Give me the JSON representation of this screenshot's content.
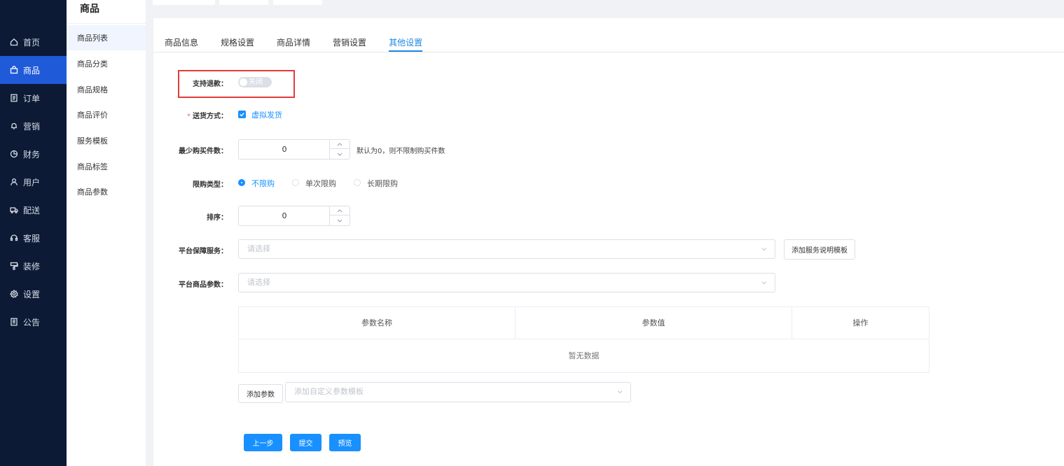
{
  "sidebar": {
    "items": [
      {
        "label": "首页",
        "icon": "home-icon"
      },
      {
        "label": "商品",
        "icon": "bag-icon"
      },
      {
        "label": "订单",
        "icon": "document-icon"
      },
      {
        "label": "营销",
        "icon": "bell-icon"
      },
      {
        "label": "财务",
        "icon": "pie-chart-icon"
      },
      {
        "label": "用户",
        "icon": "user-icon"
      },
      {
        "label": "配送",
        "icon": "truck-icon"
      },
      {
        "label": "客服",
        "icon": "headset-icon"
      },
      {
        "label": "装修",
        "icon": "brush-icon"
      },
      {
        "label": "设置",
        "icon": "gear-icon"
      },
      {
        "label": "公告",
        "icon": "notice-icon"
      }
    ]
  },
  "subnav": {
    "title": "商品",
    "items": [
      {
        "label": "商品列表"
      },
      {
        "label": "商品分类"
      },
      {
        "label": "商品规格"
      },
      {
        "label": "商品评价"
      },
      {
        "label": "服务模板"
      },
      {
        "label": "商品标签"
      },
      {
        "label": "商品参数"
      }
    ]
  },
  "tabs": [
    {
      "label": "商品信息"
    },
    {
      "label": "规格设置"
    },
    {
      "label": "商品详情"
    },
    {
      "label": "营销设置"
    },
    {
      "label": "其他设置"
    }
  ],
  "form": {
    "refund": {
      "label": "支持退款：",
      "switch_text": "关闭"
    },
    "delivery": {
      "required": "*",
      "label": "送货方式：",
      "option": "虚拟发货"
    },
    "min_purchase": {
      "label": "最少购买件数：",
      "value": "0",
      "hint": "默认为0，则不限制购买件数"
    },
    "limit_type": {
      "label": "限购类型：",
      "options": [
        {
          "label": "不限购"
        },
        {
          "label": "单次限购"
        },
        {
          "label": "长期限购"
        }
      ]
    },
    "sort": {
      "label": "排序：",
      "value": "0"
    },
    "platform_service": {
      "label": "平台保障服务：",
      "placeholder": "请选择",
      "button": "添加服务说明模板"
    },
    "platform_params": {
      "label": "平台商品参数：",
      "placeholder": "请选择"
    },
    "params_table": {
      "columns": [
        "参数名称",
        "参数值",
        "操作"
      ],
      "empty_text": "暂无数据"
    },
    "add_param": {
      "button": "添加参数",
      "placeholder": "添加自定义参数模板"
    }
  },
  "footer": {
    "prev": "上一步",
    "submit": "提交",
    "preview": "预览"
  }
}
